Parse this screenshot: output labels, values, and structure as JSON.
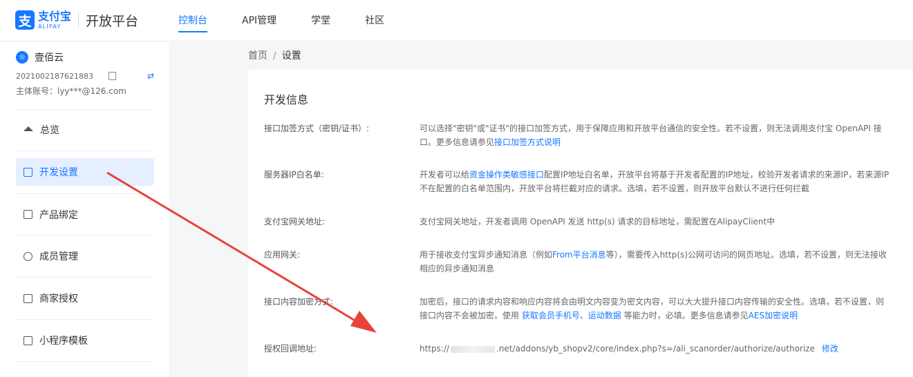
{
  "brand": {
    "logo_glyph": "支",
    "name_cn": "支付宝",
    "name_en": "ALIPAY",
    "platform": "开放平台",
    "color": "#1677ff"
  },
  "nav": {
    "items": [
      {
        "label": "控制台",
        "active": true
      },
      {
        "label": "API管理",
        "active": false
      },
      {
        "label": "学堂",
        "active": false
      },
      {
        "label": "社区",
        "active": false
      }
    ]
  },
  "account": {
    "avatar_glyph": "◎",
    "name": "壹佰云",
    "id": "2021002187621883",
    "copy_icon": "copy-icon",
    "switch_icon": "⇄",
    "main_label": "主体账号：lyy***@126.com"
  },
  "sidebar": {
    "items": [
      {
        "label": "总览",
        "icon": "home-icon",
        "active": false
      },
      {
        "label": "开发设置",
        "icon": "settings-doc-icon",
        "active": true
      },
      {
        "label": "产品绑定",
        "icon": "product-icon",
        "active": false
      },
      {
        "label": "成员管理",
        "icon": "members-icon",
        "active": false
      },
      {
        "label": "商家授权",
        "icon": "merchant-icon",
        "active": false
      },
      {
        "label": "小程序模板",
        "icon": "template-icon",
        "active": false
      }
    ]
  },
  "breadcrumb": {
    "home": "首页",
    "separator": "/",
    "current": "设置"
  },
  "panel": {
    "title": "开发信息",
    "rows": [
      {
        "label": "接口加签方式（密钥/证书）:",
        "text1": "可以选择\"密钥\"或\"证书\"的接口加签方式，用于保障应用和开放平台通信的安全性。若不设置，则无法调用支付宝 OpenAPI 接口。更多信息请参见",
        "link1": "接口加签方式说明"
      },
      {
        "label": "服务器IP白名单:",
        "text1": "开发者可以给",
        "link1": "资金操作类敏感接口",
        "text2": "配置IP地址白名单，开放平台将基于开发者配置的IP地址，校验开发者请求的来源IP，若来源IP不在配置的白名单范围内，开放平台将拦截对应的请求。选填，若不设置，则开放平台默认不进行任何拦截"
      },
      {
        "label": "支付宝网关地址:",
        "text1": "支付宝网关地址，开发者调用 OpenAPI 发送 http(s) 请求的目标地址，需配置在AlipayClient中"
      },
      {
        "label": "应用网关:",
        "text1": "用于接收支付宝异步通知消息（例如",
        "link1": "From平台消息",
        "text2": "等），需要传入http(s)公网可访问的网页地址。选填，若不设置，则无法接收相应的异步通知消息"
      },
      {
        "label": "接口内容加密方式:",
        "text1": "加密后，接口的请求内容和响应内容将会由明文内容变为密文内容，可以大大提升接口内容传输的安全性。选填，若不设置，则接口内容不会被加密。使用 ",
        "link1": "获取会员手机号",
        "text2": "、",
        "link2": "运动数据",
        "text3": " 等能力时，必填。更多信息请参见",
        "link3": "AES加密说明"
      },
      {
        "label": "授权回调地址:",
        "url_prefix": "https://",
        "url_suffix": ".net/addons/yb_shopv2/core/index.php?s=/ali_scanorder/authorize/authorize",
        "action": "修改"
      }
    ]
  },
  "annotation": {
    "arrow_color": "#e8423a"
  }
}
